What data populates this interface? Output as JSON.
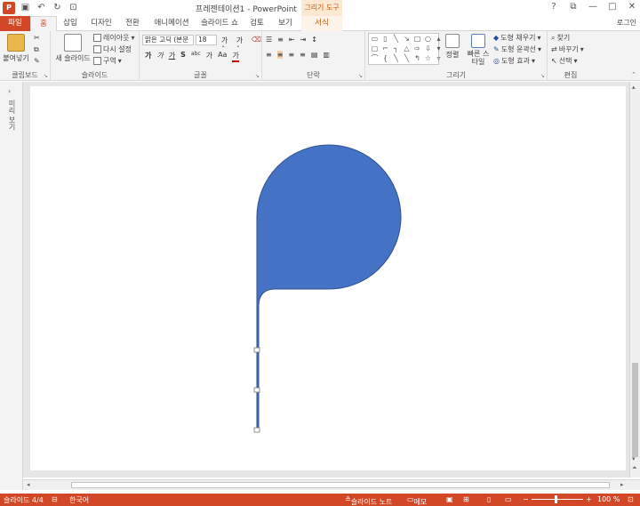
{
  "title_bar": {
    "window_title": "프레젠테이션1 - PowerPoint",
    "contextual_tab_group": "그리기 도구",
    "app_logo": "P",
    "quick_access": [
      "save-icon",
      "undo-icon",
      "redo-icon",
      "autofit-icon"
    ]
  },
  "tabs": [
    {
      "label": "파일"
    },
    {
      "label": "홈"
    },
    {
      "label": "삽입"
    },
    {
      "label": "디자인"
    },
    {
      "label": "전환"
    },
    {
      "label": "애니메이션"
    },
    {
      "label": "슬라이드 쇼"
    },
    {
      "label": "검토"
    },
    {
      "label": "보기"
    },
    {
      "label": "서식"
    }
  ],
  "active_tab": "홈",
  "login_label": "로그인",
  "ribbon": {
    "clipboard": {
      "paste_label": "붙여넣기",
      "group_label": "클립보드"
    },
    "slides": {
      "new_slide_label": "새 슬라이드",
      "layout_label": "레이아웃",
      "reset_label": "다시 설정",
      "section_label": "구역",
      "group_label": "슬라이드"
    },
    "font": {
      "font_name": "맑은 고딕 (본문",
      "font_size": "18",
      "group_label": "글꼴",
      "format_buttons": [
        "가",
        "가",
        "가",
        "S",
        "abc",
        "가",
        "Aa",
        "가"
      ]
    },
    "paragraph": {
      "group_label": "단락"
    },
    "drawing": {
      "arrange_label": "정렬",
      "quick_style_label": "빠른 스타일",
      "fill_label": "도형 채우기",
      "outline_label": "도형 윤곽선",
      "effects_label": "도형 효과",
      "group_label": "그리기"
    },
    "editing": {
      "find_label": "찾기",
      "replace_label": "바꾸기",
      "select_label": "선택",
      "group_label": "편집"
    }
  },
  "side_pane": {
    "label": "미리 보기"
  },
  "shape": {
    "fill_color": "#4472c4",
    "outline_color": "#2f528f"
  },
  "status_bar": {
    "slide_info": "슬라이드 4/4",
    "language": "한국어",
    "notes_label": "슬라이드 노트",
    "comments_label": "메모",
    "zoom_level": "100 %"
  },
  "colors": {
    "accent": "#d24726",
    "ribbon_bg": "#f3f3f3",
    "editor_bg": "#e6e6e6"
  }
}
